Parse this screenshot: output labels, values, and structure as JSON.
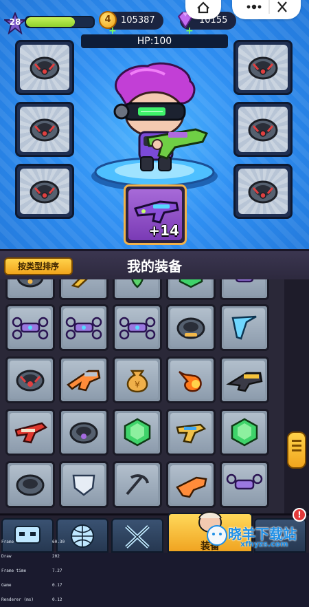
{
  "status": {
    "level": "28",
    "xp_progress": 0.72,
    "gold": "105387",
    "gold_badge": "4",
    "gems": "10155"
  },
  "hp_label": "HP:100",
  "weapon_slot": {
    "bonus": "+14"
  },
  "equipment_panel": {
    "sort_button": "按类型排序",
    "title": "我的装备"
  },
  "bottom_nav": {
    "active_tab_label": "装备",
    "alert_badge": "!"
  },
  "debug_overlay": {
    "labels": [
      "Frame",
      "Draw",
      "Frame time",
      "Game",
      "Renderer (ms)"
    ],
    "values": [
      "60.30",
      "202",
      "7.27",
      "0.17",
      "0.12"
    ]
  },
  "watermark": {
    "title": "晓羊下载站",
    "url": "xfhyzs.com"
  },
  "colors": {
    "accent": "#f1a51d",
    "top_bg": "#2f8ff2",
    "panel_bg": "#2a2838"
  }
}
